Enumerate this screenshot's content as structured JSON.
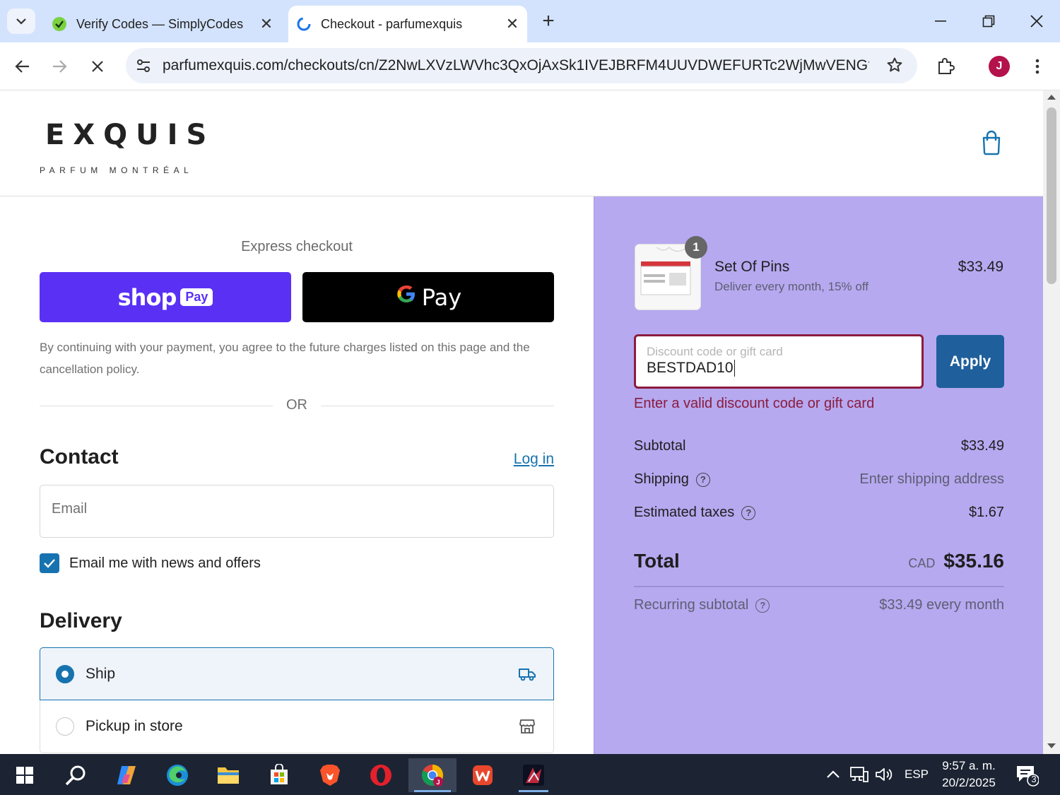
{
  "browser": {
    "tabs": [
      {
        "title": "Verify Codes — SimplyCodes",
        "active": false
      },
      {
        "title": "Checkout - parfumexquis",
        "active": true
      }
    ],
    "url": "parfumexquis.com/checkouts/cn/Z2NwLXVzLWVhc3QxOjAxSk1IVEJBRFM4UUVDWEFURTc2WjMwVENG?_ga=...",
    "profile_initial": "J",
    "profile_color": "#b3124a"
  },
  "store": {
    "logo_word": "EXQUIS",
    "logo_sub": "PARFUM MONTRÉAL"
  },
  "checkout": {
    "express_label": "Express checkout",
    "shop_pay": {
      "shop": "shop",
      "pay": "Pay"
    },
    "gpay": {
      "g": "G",
      "pay": "Pay"
    },
    "consent": "By continuing with your payment, you agree to the future charges listed on this page and the cancellation policy.",
    "or": "OR",
    "contact_heading": "Contact",
    "login_link": "Log in",
    "email_placeholder": "Email",
    "newsletter_label": "Email me with news and offers",
    "newsletter_checked": true,
    "delivery_heading": "Delivery",
    "delivery_options": [
      {
        "label": "Ship",
        "selected": true,
        "icon": "truck-icon"
      },
      {
        "label": "Pickup in store",
        "selected": false,
        "icon": "store-icon"
      }
    ]
  },
  "summary": {
    "product": {
      "name": "Set Of Pins",
      "variant": "Deliver every month, 15% off",
      "price": "$33.49",
      "quantity": "1"
    },
    "discount": {
      "placeholder": "Discount code or gift card",
      "value": "BESTDAD10",
      "apply_label": "Apply",
      "error": "Enter a valid discount code or gift card"
    },
    "subtotal": {
      "label": "Subtotal",
      "value": "$33.49"
    },
    "shipping": {
      "label": "Shipping",
      "value": "Enter shipping address"
    },
    "taxes": {
      "label": "Estimated taxes",
      "value": "$1.67"
    },
    "total": {
      "label": "Total",
      "currency": "CAD",
      "value": "$35.16"
    },
    "recurring": {
      "label": "Recurring subtotal",
      "value": "$33.49 every month"
    },
    "panel_color": "#b6a9f0"
  },
  "taskbar": {
    "apps": [
      "windows-start-icon",
      "search-icon",
      "copilot-icon",
      "edge-icon",
      "file-explorer-icon",
      "ms-store-icon",
      "brave-icon",
      "opera-icon",
      "chrome-icon",
      "wps-office-icon",
      "game-app-icon"
    ],
    "language": "ESP",
    "time": "9:57 a. m.",
    "date": "20/2/2025",
    "notifications": "3"
  }
}
